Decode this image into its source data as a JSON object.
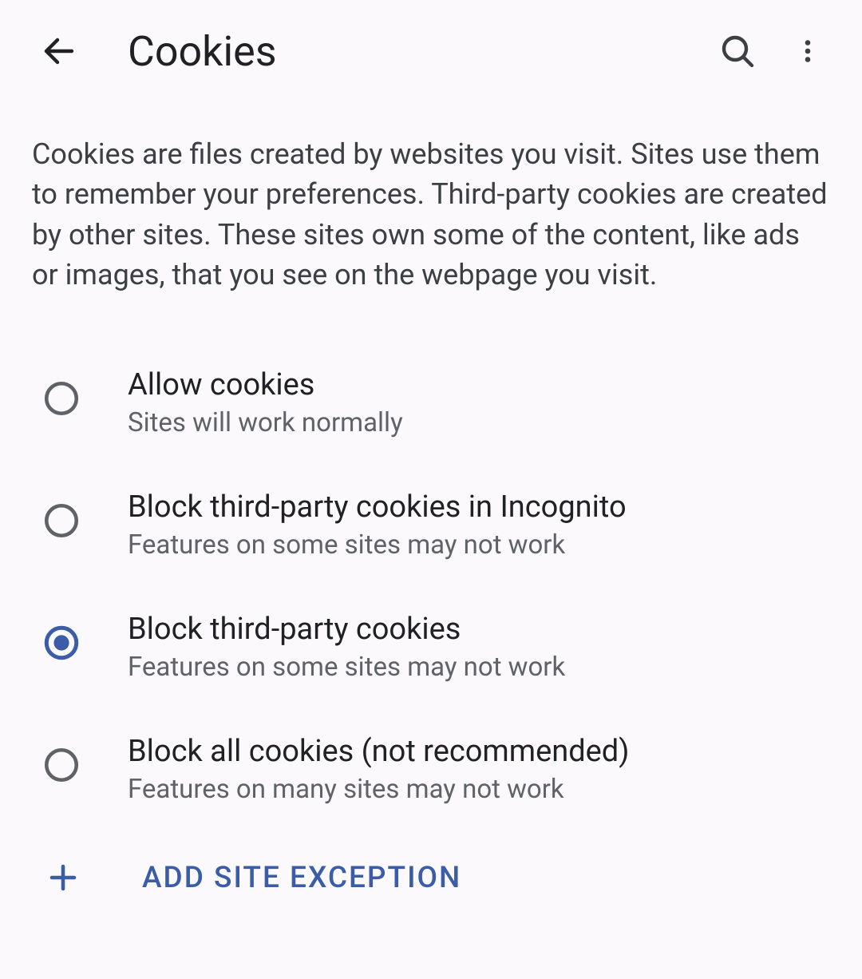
{
  "header": {
    "title": "Cookies"
  },
  "description": "Cookies are files created by websites you visit. Sites use them to remember your preferences. Third-party cookies are created by other sites. These sites own some of the content, like ads or images, that you see on the webpage you visit.",
  "options": [
    {
      "title": "Allow cookies",
      "desc": "Sites will work normally",
      "selected": false
    },
    {
      "title": "Block third-party cookies in Incognito",
      "desc": "Features on some sites may not work",
      "selected": false
    },
    {
      "title": "Block third-party cookies",
      "desc": "Features on some sites may not work",
      "selected": true
    },
    {
      "title": "Block all cookies (not recommended)",
      "desc": "Features on many sites may not work",
      "selected": false
    }
  ],
  "add_exception_label": "ADD SITE EXCEPTION",
  "colors": {
    "accent": "#3b5da8",
    "radio_unselected": "#5f6368"
  }
}
